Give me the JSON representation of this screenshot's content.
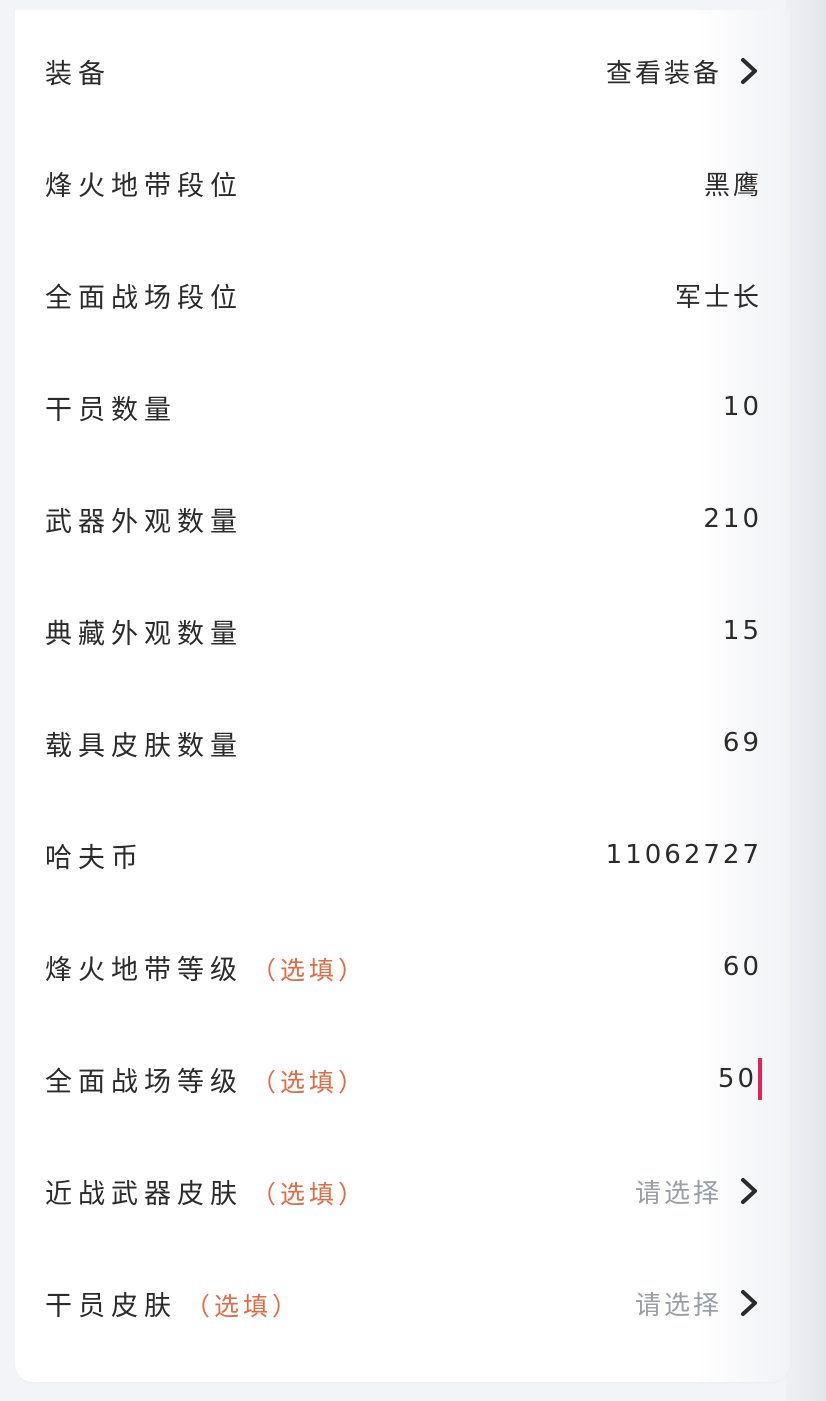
{
  "rows": [
    {
      "label": "装备",
      "value": "查看装备"
    },
    {
      "label": "烽火地带段位",
      "value": "黑鹰"
    },
    {
      "label": "全面战场段位",
      "value": "军士长"
    },
    {
      "label": "干员数量",
      "value": "10"
    },
    {
      "label": "武器外观数量",
      "value": "210"
    },
    {
      "label": "典藏外观数量",
      "value": "15"
    },
    {
      "label": "载具皮肤数量",
      "value": "69"
    },
    {
      "label": "哈夫币",
      "value": "11062727"
    },
    {
      "label": "烽火地带等级",
      "optional": "（选填）",
      "value": "60"
    },
    {
      "label": "全面战场等级",
      "optional": "（选填）",
      "value": "50"
    },
    {
      "label": "近战武器皮肤",
      "optional": "（选填）",
      "placeholder": "请选择"
    },
    {
      "label": "干员皮肤",
      "optional": "（选填）",
      "placeholder": "请选择"
    }
  ],
  "colors": {
    "optional": "#e06b45",
    "caret": "#e0245e",
    "placeholder": "#9a9ea6",
    "text": "#2b2b2b"
  },
  "icons": {
    "chevron": "chevron-right-icon"
  }
}
